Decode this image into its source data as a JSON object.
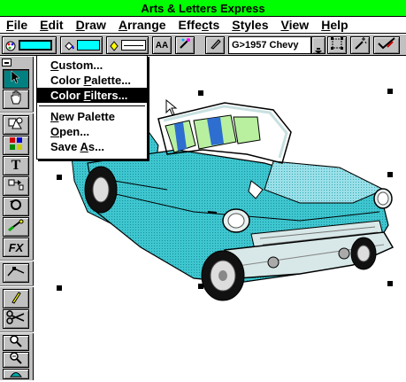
{
  "window": {
    "title": "Arts & Letters Express"
  },
  "menubar": {
    "items": [
      {
        "id": "file",
        "pre": "",
        "ul": "F",
        "post": "ile"
      },
      {
        "id": "edit",
        "pre": "",
        "ul": "E",
        "post": "dit"
      },
      {
        "id": "draw",
        "pre": "",
        "ul": "D",
        "post": "raw"
      },
      {
        "id": "arrange",
        "pre": "",
        "ul": "A",
        "post": "rrange"
      },
      {
        "id": "effects",
        "pre": "Effe",
        "ul": "c",
        "post": "ts"
      },
      {
        "id": "styles",
        "pre": "",
        "ul": "S",
        "post": "tyles"
      },
      {
        "id": "view",
        "pre": "",
        "ul": "V",
        "post": "iew"
      },
      {
        "id": "help",
        "pre": "",
        "ul": "H",
        "post": "elp"
      }
    ]
  },
  "toolbar": {
    "style_select_value": "G>1957 Chevy",
    "text_button_label": "AA",
    "line_fill_color": "#00ffff"
  },
  "popup_menu": {
    "items": [
      {
        "pre": "",
        "ul": "C",
        "post": "ustom...",
        "selected": false
      },
      {
        "pre": "Color ",
        "ul": "P",
        "post": "alette...",
        "selected": false
      },
      {
        "pre": "Color ",
        "ul": "F",
        "post": "ilters...",
        "selected": true
      },
      {
        "pre": "",
        "ul": "N",
        "post": "ew Palette",
        "selected": false
      },
      {
        "pre": "",
        "ul": "O",
        "post": "pen...",
        "selected": false
      },
      {
        "pre": "Save ",
        "ul": "A",
        "post": "s...",
        "selected": false
      }
    ]
  },
  "toolbox": {
    "text_tool_label": "T",
    "fx_tool_label": "FX",
    "tools": [
      "arrow-tool",
      "hand-tool",
      "shapes-tool",
      "symbols-tool",
      "text-tool",
      "connector-tool",
      "rotate-tool",
      "gradient-tool",
      "fx-tool",
      "line-tool",
      "pen-tool",
      "scissors-tool",
      "zoom-tool",
      "zoom-out-tool",
      "paint-bucket-tool"
    ]
  },
  "colors": {
    "titlebar_bg": "#00ff00",
    "car_body": "#33c8d0",
    "car_seats": "#b8f0a0",
    "chrome": "#d8e8e8"
  }
}
